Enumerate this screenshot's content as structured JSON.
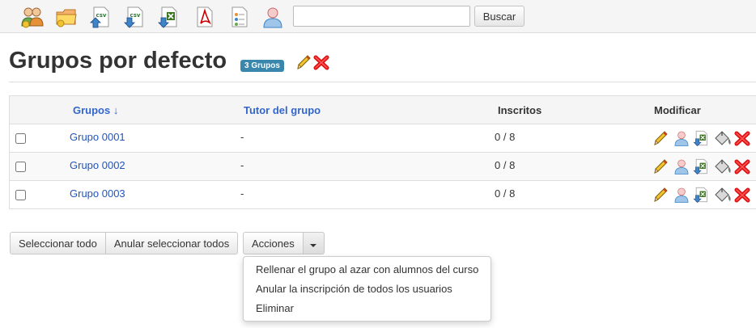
{
  "toolbar": {
    "icons": [
      {
        "name": "group-users-icon",
        "label": ""
      },
      {
        "name": "folder-icon",
        "label": ""
      },
      {
        "name": "csv-import-icon",
        "label": "csv"
      },
      {
        "name": "csv-export-icon",
        "label": "csv"
      },
      {
        "name": "excel-export-icon",
        "label": ""
      },
      {
        "name": "pdf-icon",
        "label": ""
      },
      {
        "name": "document-icon",
        "label": ""
      },
      {
        "name": "user-icon",
        "label": ""
      }
    ],
    "search": {
      "value": "",
      "placeholder": ""
    },
    "search_button": "Buscar"
  },
  "header": {
    "title": "Grupos por defecto",
    "badge": "3 Grupos"
  },
  "table": {
    "columns": {
      "groups": "Grupos ↓",
      "tutor": "Tutor del grupo",
      "enrolled": "Inscritos",
      "modify": "Modificar"
    },
    "rows": [
      {
        "name": "Grupo 0001",
        "tutor": "-",
        "enrolled": "0 / 8"
      },
      {
        "name": "Grupo 0002",
        "tutor": "-",
        "enrolled": "0 / 8"
      },
      {
        "name": "Grupo 0003",
        "tutor": "-",
        "enrolled": "0 / 8"
      }
    ]
  },
  "buttons": {
    "select_all": "Seleccionar todo",
    "deselect_all": "Anular seleccionar todos",
    "actions": "Acciones"
  },
  "actions_menu": [
    "Rellenar el grupo al azar con alumnos del curso",
    "Anular la inscripción de todos los usuarios",
    "Eliminar"
  ],
  "colors": {
    "link": "#3366cc",
    "badge": "#3a87ad",
    "delete": "#dd1111",
    "pencil": "#e8a318"
  }
}
